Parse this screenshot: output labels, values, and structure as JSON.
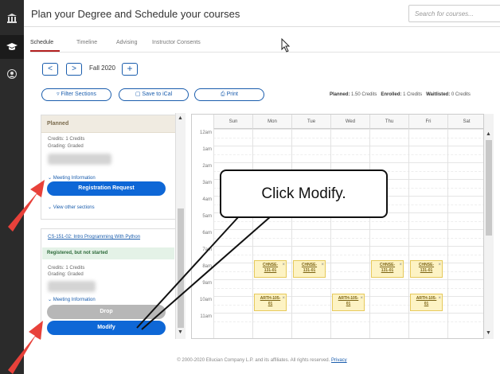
{
  "header": {
    "title": "Plan your Degree and Schedule your courses",
    "search_placeholder": "Search for courses..."
  },
  "tabs": [
    "Schedule",
    "Timeline",
    "Advising",
    "Instructor Consents"
  ],
  "term": {
    "prev": "<",
    "next": ">",
    "label": "Fall 2020",
    "add": "+"
  },
  "actions": {
    "filter": "Filter Sections",
    "ical": "Save to iCal",
    "print": "Print"
  },
  "summary": {
    "planned_label": "Planned:",
    "planned_value": "1.50 Credits",
    "enrolled_label": "Enrolled:",
    "enrolled_value": "1 Credits",
    "waitlisted_label": "Waitlisted:",
    "waitlisted_value": "0 Credits"
  },
  "planned_card": {
    "status": "Planned",
    "credits": "Credits: 1 Credits",
    "grading": "Grading: Graded",
    "meeting": "Meeting Information",
    "request": "Registration Request",
    "other": "View other sections"
  },
  "course_card": {
    "link": "CS-151-02: Intro Programming With Python",
    "status": "Registered, but not started",
    "credits": "Credits: 1 Credits",
    "grading": "Grading: Graded",
    "meeting": "Meeting Information",
    "drop": "Drop",
    "modify": "Modify"
  },
  "calendar": {
    "days": [
      "Sun",
      "Mon",
      "Tue",
      "Wed",
      "Thu",
      "Fri",
      "Sat"
    ],
    "hours": [
      "12am",
      "1am",
      "2am",
      "3am",
      "4am",
      "5am",
      "6am",
      "7am",
      "8am",
      "9am",
      "10am",
      "11am"
    ],
    "events": [
      {
        "code": "CHNSE-",
        "section": "131-01",
        "day": 1,
        "row": 8
      },
      {
        "code": "CHNSE-",
        "section": "131-01",
        "day": 2,
        "row": 8
      },
      {
        "code": "CHNSE-",
        "section": "131-01",
        "day": 4,
        "row": 8
      },
      {
        "code": "CHNSE-",
        "section": "131-01",
        "day": 5,
        "row": 8
      },
      {
        "code": "ARTH-105-",
        "section": "01",
        "day": 1,
        "row": 10
      },
      {
        "code": "ARTH-105-",
        "section": "01",
        "day": 3,
        "row": 10
      },
      {
        "code": "ARTH-105-",
        "section": "01",
        "day": 5,
        "row": 10
      }
    ]
  },
  "callout": "Click Modify.",
  "footer": {
    "text": "© 2000-2020 Ellucian Company L.P. and its affiliates. All rights reserved.",
    "privacy": "Privacy"
  },
  "colors": {
    "primary": "#1a5dad",
    "button_blue": "#0e67d6",
    "arrow_red": "#e8413a",
    "event_fill": "#fdf3c4"
  },
  "icons": [
    "bank-icon",
    "graduation-cap-icon",
    "user-icon",
    "search-icon",
    "filter-icon",
    "calendar-icon",
    "print-icon",
    "chevron-down-icon",
    "cursor-icon"
  ]
}
